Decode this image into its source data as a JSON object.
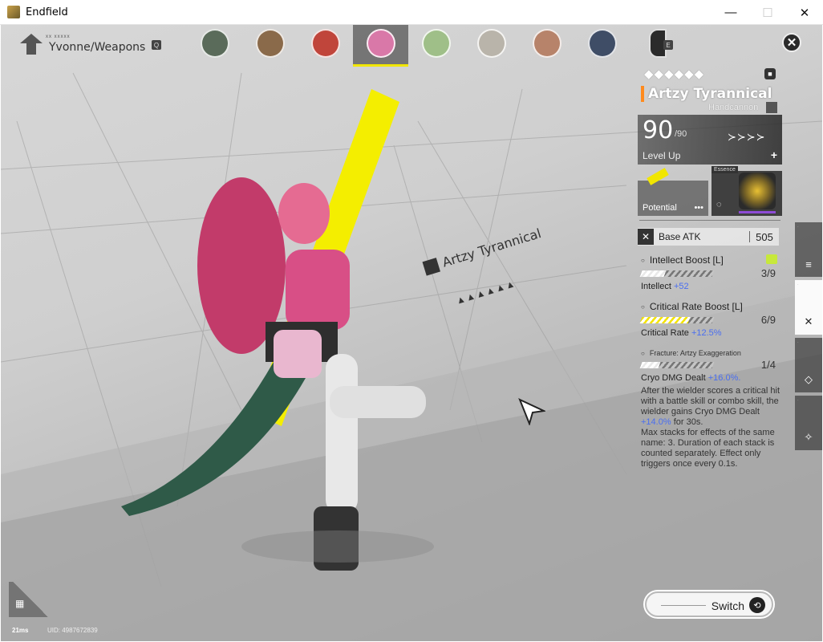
{
  "window": {
    "title": "Endfield",
    "min": "—",
    "max": "☐",
    "close": "✕"
  },
  "topbar": {
    "breadcrumb_sub": "xx xxxxx",
    "breadcrumb": "Yvonne/Weapons",
    "search_key": "Q",
    "next_key": "E",
    "characters": [
      {
        "color": "#5a6b5a"
      },
      {
        "color": "#8a6a4a"
      },
      {
        "color": "#c0453b"
      },
      {
        "color": "#d978a8"
      },
      {
        "color": "#9fbf88"
      },
      {
        "color": "#b9b4aa"
      },
      {
        "color": "#b7836a"
      },
      {
        "color": "#3f4d66"
      },
      {
        "color": "#2b2b2b"
      }
    ],
    "active_index": 3,
    "close_icon": "✕"
  },
  "scene": {
    "weapon_label": "Artzy Tyrannical",
    "stars": "▲▲▲▲▲▲"
  },
  "panel": {
    "stars": "◆◆◆◆◆◆",
    "weapon_name": "Artzy Tyrannical",
    "weapon_type": "Handcannon",
    "level": "90",
    "level_max": "/90",
    "level_up": "Level Up",
    "pips": "≻≻≻≻",
    "plus": "+",
    "potential_label": "Potential",
    "potential_more": "•••",
    "essence_tag": "Essence",
    "base_atk_label": "Base ATK",
    "base_atk_value": "505",
    "skills": [
      {
        "title": "Intellect Boost [L]",
        "progress": "3/9",
        "fill": 0.33,
        "effect_label": "Intellect",
        "effect_value": "+52"
      },
      {
        "title": "Critical Rate Boost [L]",
        "progress": "6/9",
        "fill": 0.67,
        "effect_label": "Critical Rate",
        "effect_value": "+12.5%"
      },
      {
        "title": "Fracture: Artzy Exaggeration",
        "progress": "1/4",
        "fill": 0.25,
        "effect_label": "Cryo DMG Dealt",
        "effect_value": "+16.0%.",
        "desc1": "After the wielder scores a critical hit with a battle skill or combo skill, the wielder gains Cryo DMG Dealt",
        "desc1_value": "+14.0%",
        "desc1_tail": "for 30s.",
        "desc2": "Max stacks for effects of the same name: 3. Duration of each stack is counted separately. Effect only triggers once every 0.1s."
      }
    ]
  },
  "bottom": {
    "ping": "21ms",
    "uid": "UID: 4987672839",
    "switch_label": "Switch"
  }
}
